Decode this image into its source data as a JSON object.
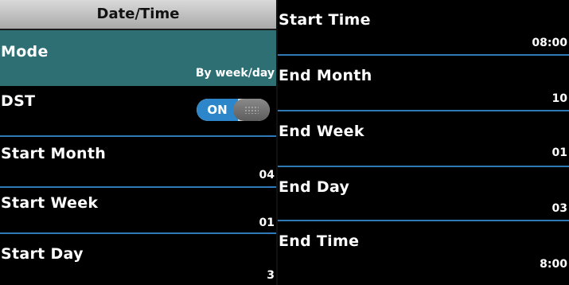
{
  "left_panel": {
    "title": "Date/Time",
    "items": [
      {
        "label": "Mode",
        "value": "By week/day"
      },
      {
        "label": "DST",
        "toggle": "ON"
      },
      {
        "label": "Start Month",
        "value": "04"
      },
      {
        "label": "Start Week",
        "value": "01"
      },
      {
        "label": "Start Day",
        "value": "3"
      }
    ]
  },
  "right_panel": {
    "items": [
      {
        "label": "Start Time",
        "value": "08:00"
      },
      {
        "label": "End Month",
        "value": "10"
      },
      {
        "label": "End Week",
        "value": "01"
      },
      {
        "label": "End Day",
        "value": "03"
      },
      {
        "label": "End Time",
        "value": "8:00"
      }
    ]
  },
  "colors": {
    "selected_bg": "#2e6f73",
    "separator": "#2f79b6",
    "toggle_on": "#2c86c9"
  }
}
